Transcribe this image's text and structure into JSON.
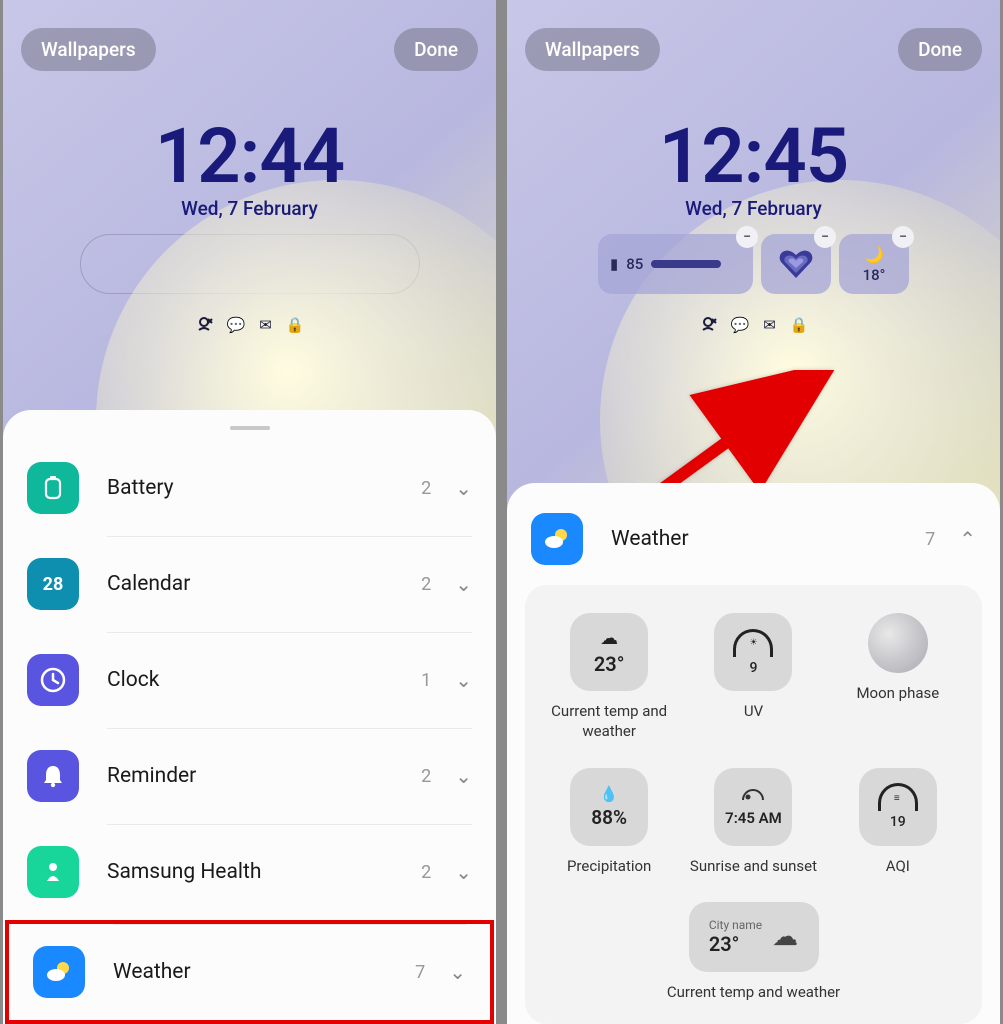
{
  "left": {
    "wallpapers": "Wallpapers",
    "done": "Done",
    "time": "12:44",
    "date": "Wed, 7 February",
    "categories": [
      {
        "name": "Battery",
        "count": "2",
        "icon": "battery",
        "color": "#0fb89b"
      },
      {
        "name": "Calendar",
        "count": "2",
        "icon": "calendar",
        "day": "28",
        "color": "#0e8fb0"
      },
      {
        "name": "Clock",
        "count": "1",
        "icon": "clock",
        "color": "#5a55e0"
      },
      {
        "name": "Reminder",
        "count": "2",
        "icon": "reminder",
        "color": "#5a55e0"
      },
      {
        "name": "Samsung Health",
        "count": "2",
        "icon": "health",
        "color": "#18d69a"
      },
      {
        "name": "Weather",
        "count": "7",
        "icon": "weather",
        "color": "#1a88ff"
      }
    ]
  },
  "right": {
    "wallpapers": "Wallpapers",
    "done": "Done",
    "time": "12:45",
    "date": "Wed, 7 February",
    "widgets": {
      "battery": "85",
      "temp": "18°"
    },
    "weatherHeader": {
      "title": "Weather",
      "count": "7"
    },
    "options": [
      {
        "label": "Current temp and weather",
        "line1": "",
        "line2": "23°",
        "icon": "cloud"
      },
      {
        "label": "UV",
        "line1": "",
        "line2": "9",
        "icon": "gauge"
      },
      {
        "label": "Moon phase",
        "line1": "",
        "line2": "",
        "icon": "moon"
      },
      {
        "label": "Precipitation",
        "line1": "",
        "line2": "88%",
        "icon": "drop"
      },
      {
        "label": "Sunrise and sunset",
        "line1": "",
        "line2": "7:45 AM",
        "icon": "sun"
      },
      {
        "label": "AQI",
        "line1": "",
        "line2": "19",
        "icon": "gauge"
      },
      {
        "label": "Current temp and weather",
        "city": "City name",
        "line2": "23°",
        "icon": "citycloud"
      }
    ]
  }
}
